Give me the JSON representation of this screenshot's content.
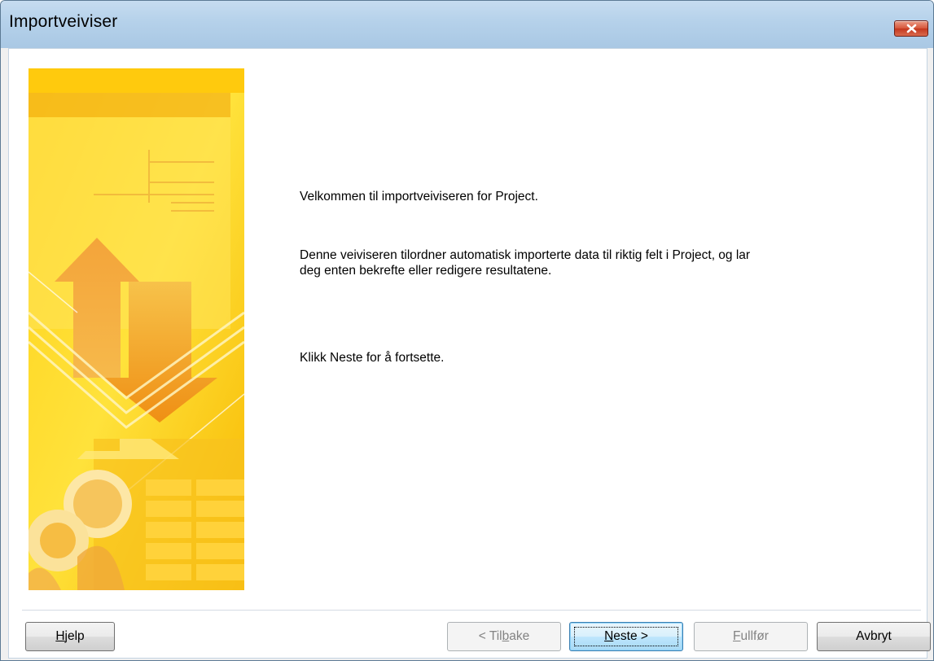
{
  "window": {
    "title": "Importveiviser"
  },
  "intro": {
    "welcome": "Velkommen til importveiviseren for Project.",
    "description": "Denne veiviseren tilordner automatisk importerte data til riktig felt i Project, og lar deg enten bekrefte eller redigere resultatene.",
    "instruction": "Klikk Neste for å fortsette."
  },
  "buttons": {
    "help": {
      "pre": "",
      "accel": "H",
      "post": "jelp",
      "enabled": true
    },
    "back": {
      "pre": "< Til",
      "accel": "b",
      "post": "ake",
      "enabled": false
    },
    "next": {
      "pre": "",
      "accel": "N",
      "post": "este >",
      "enabled": true,
      "default": true
    },
    "finish": {
      "pre": "",
      "accel": "F",
      "post": "ullfør",
      "enabled": false
    },
    "cancel": {
      "label": "Avbryt",
      "enabled": true
    }
  },
  "colors": {
    "banner_primary": "#f9c400",
    "banner_accent": "#f49a16",
    "titlebar": "#b5d1ea",
    "close_button": "#d6553a"
  },
  "icons": {
    "close": "close-x-icon"
  }
}
